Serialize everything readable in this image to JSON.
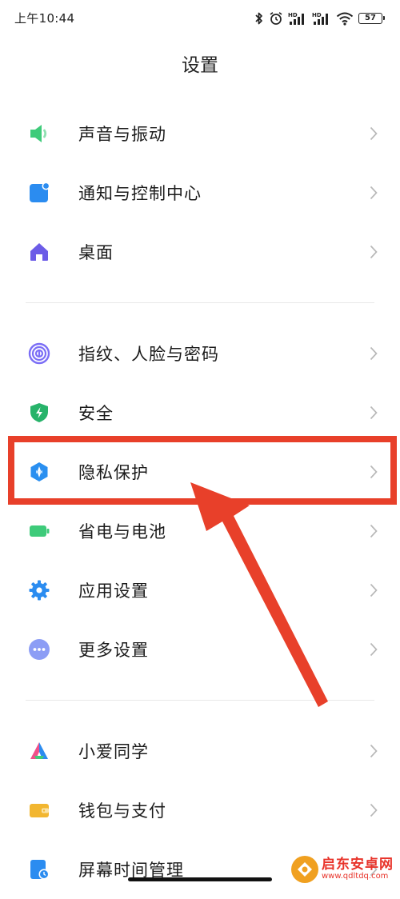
{
  "status_bar": {
    "time": "上午10:44",
    "battery": "57",
    "icons": [
      "bluetooth-icon",
      "alarm-icon",
      "hd-signal-icon",
      "hd-signal-icon",
      "wifi-icon",
      "battery-icon"
    ]
  },
  "page_title": "设置",
  "groups": [
    {
      "items": [
        {
          "label": "声音与振动",
          "icon": "speaker-icon",
          "color": "#3ecb7a"
        },
        {
          "label": "通知与控制中心",
          "icon": "notification-icon",
          "color": "#2b8cf0"
        },
        {
          "label": "桌面",
          "icon": "home-icon",
          "color": "#6c5ce7"
        }
      ]
    },
    {
      "items": [
        {
          "label": "指纹、人脸与密码",
          "icon": "fingerprint-icon",
          "color": "#7b6ef6"
        },
        {
          "label": "安全",
          "icon": "shield-icon",
          "color": "#27b36a"
        },
        {
          "label": "隐私保护",
          "icon": "privacy-icon",
          "color": "#2a8ff0"
        },
        {
          "label": "省电与电池",
          "icon": "battery-saver-icon",
          "color": "#3ecb7a"
        },
        {
          "label": "应用设置",
          "icon": "app-settings-gear-icon",
          "color": "#2b8cf0"
        },
        {
          "label": "更多设置",
          "icon": "more-settings-icon",
          "color": "#8c9df5"
        }
      ]
    },
    {
      "items": [
        {
          "label": "小爱同学",
          "icon": "xiaoai-icon",
          "color": "#2b8cf0"
        },
        {
          "label": "钱包与支付",
          "icon": "wallet-icon",
          "color": "#f2b630"
        },
        {
          "label": "屏幕时间管理",
          "icon": "screen-time-icon",
          "color": "#2b8cf0"
        }
      ]
    }
  ],
  "annotation": {
    "highlight_color": "#e8402a",
    "highlighted_item": "隐私保护"
  },
  "watermark": {
    "name": "启东安卓网",
    "url": "www.qdltdq.com"
  }
}
